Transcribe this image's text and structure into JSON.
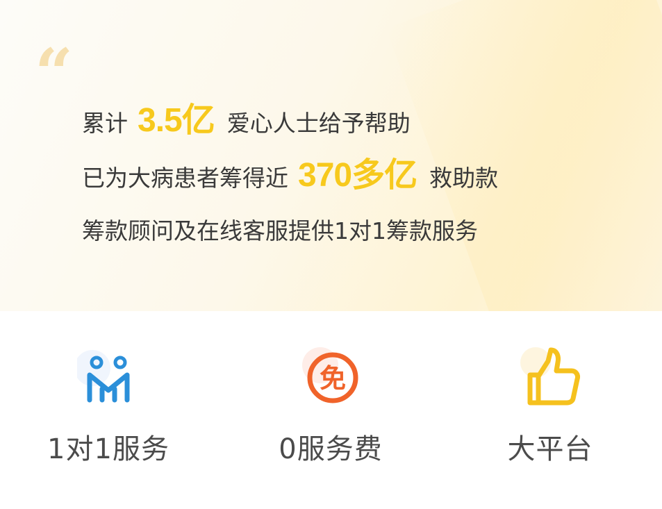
{
  "quote_mark": "“",
  "lines": {
    "line1": {
      "prefix": "累计",
      "highlight": "3.5亿",
      "suffix": "爱心人士给予帮助"
    },
    "line2": {
      "prefix": "已为大病患者筹得近",
      "highlight": "370多亿",
      "suffix": "救助款"
    },
    "line3": {
      "text": "筹款顾问及在线客服提供1对1筹款服务"
    }
  },
  "features": [
    {
      "label": "1对1服务",
      "icon": "people-icon",
      "color": "#2b8fd9"
    },
    {
      "label": "0服务费",
      "icon": "free-icon",
      "color": "#f0632a",
      "glyph": "免"
    },
    {
      "label": "大平台",
      "icon": "thumbs-up-icon",
      "color": "#f5c11e"
    }
  ],
  "colors": {
    "highlight": "#f7c91d",
    "text": "#3a3a3a",
    "quote": "#f6dfae"
  }
}
